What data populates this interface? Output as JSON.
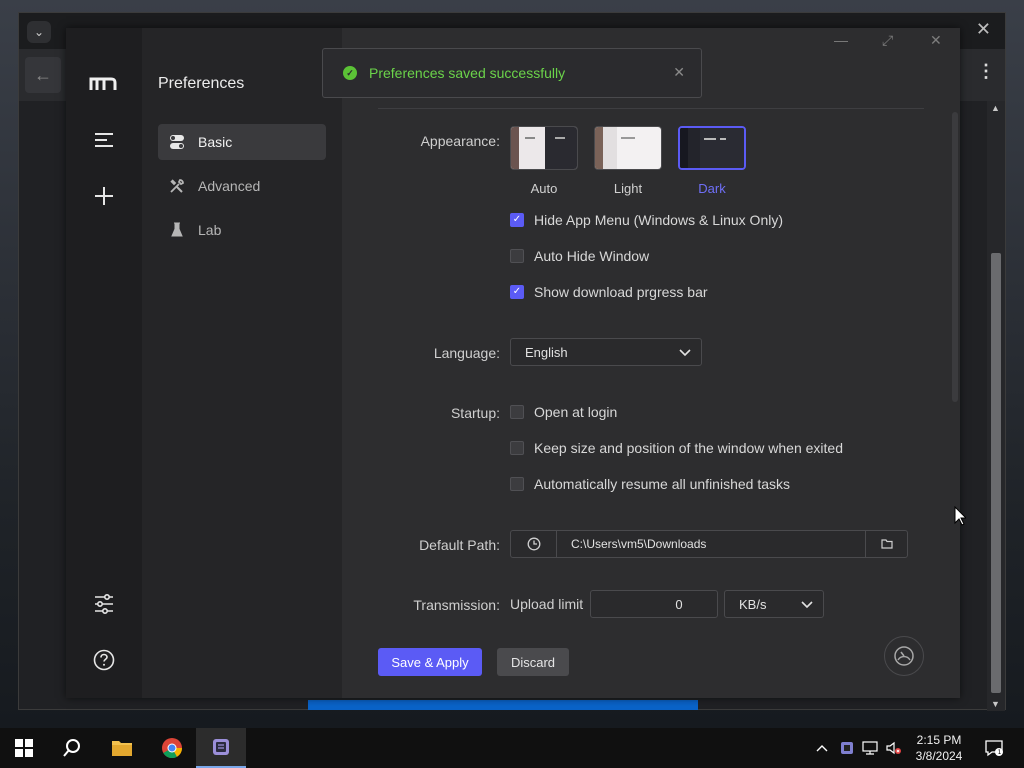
{
  "app": {
    "sidebar_title": "Preferences",
    "nav": [
      {
        "label": "Basic",
        "icon": "toggle-icon",
        "active": true
      },
      {
        "label": "Advanced",
        "icon": "tools-icon",
        "active": false
      },
      {
        "label": "Lab",
        "icon": "flask-icon",
        "active": false
      }
    ]
  },
  "toast": {
    "message": "Preferences saved successfully"
  },
  "form": {
    "appearance_label": "Appearance:",
    "themes": [
      {
        "label": "Auto",
        "selected": false
      },
      {
        "label": "Light",
        "selected": false
      },
      {
        "label": "Dark",
        "selected": true
      }
    ],
    "appearance_options": [
      {
        "label": "Hide App Menu (Windows & Linux Only)",
        "checked": true
      },
      {
        "label": "Auto Hide Window",
        "checked": false
      },
      {
        "label": "Show download prgress bar",
        "checked": true
      }
    ],
    "language_label": "Language:",
    "language_value": "English",
    "startup_label": "Startup:",
    "startup_options": [
      {
        "label": "Open at login",
        "checked": false
      },
      {
        "label": "Keep size and position of the window when exited",
        "checked": false
      },
      {
        "label": "Automatically resume all unfinished tasks",
        "checked": false
      }
    ],
    "default_path_label": "Default Path:",
    "default_path_value": "C:\\Users\\vm5\\Downloads",
    "transmission_label": "Transmission:",
    "upload_limit_label": "Upload limit",
    "upload_limit_value": "0",
    "upload_unit": "KB/s"
  },
  "buttons": {
    "save": "Save & Apply",
    "discard": "Discard"
  },
  "taskbar": {
    "time": "2:15 PM",
    "date": "3/8/2024"
  },
  "colors": {
    "accent": "#5b5bf5",
    "success": "#6bd34a",
    "browser_progress": "#0a63c8"
  }
}
